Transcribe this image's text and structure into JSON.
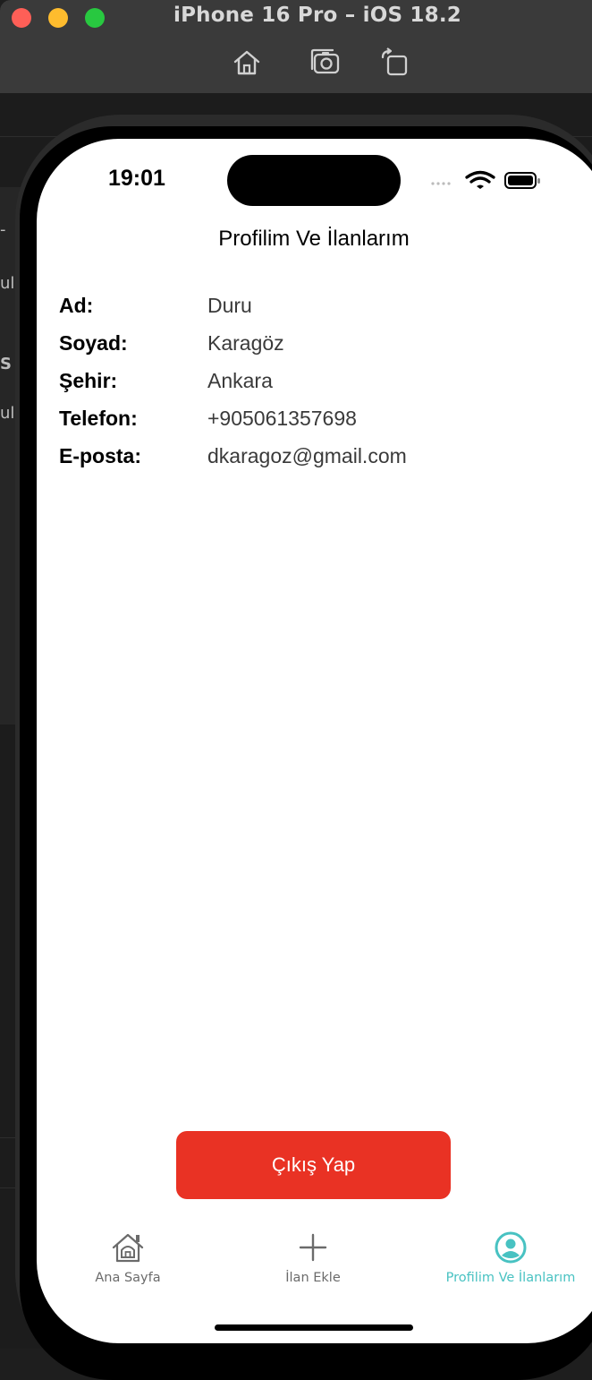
{
  "window": {
    "title": "iPhone 16 Pro – iOS 18.2",
    "toolbar_icons": [
      "home-icon",
      "screenshot-icon",
      "rotate-icon"
    ]
  },
  "backdrop": {
    "peek_texts": [
      "-",
      "ul",
      "S",
      "ul"
    ]
  },
  "status_bar": {
    "time": "19:01"
  },
  "page": {
    "title": "Profilim Ve İlanlarım",
    "fields": [
      {
        "label": "Ad:",
        "value": "Duru"
      },
      {
        "label": "Soyad:",
        "value": "Karagöz"
      },
      {
        "label": "Şehir:",
        "value": "Ankara"
      },
      {
        "label": "Telefon:",
        "value": "+905061357698"
      },
      {
        "label": "E-posta:",
        "value": "dkaragoz@gmail.com"
      }
    ],
    "logout_label": "Çıkış Yap"
  },
  "tabbar": {
    "tabs": [
      {
        "label": "Ana Sayfa",
        "icon": "home-icon",
        "active": false
      },
      {
        "label": "İlan Ekle",
        "icon": "plus-icon",
        "active": false
      },
      {
        "label": "Profilim Ve İlanlarım",
        "icon": "person-circle-icon",
        "active": true
      }
    ]
  },
  "colors": {
    "accent": "#48c2c2",
    "logout": "#e93224",
    "inactive_tab": "#6b6b6b"
  }
}
